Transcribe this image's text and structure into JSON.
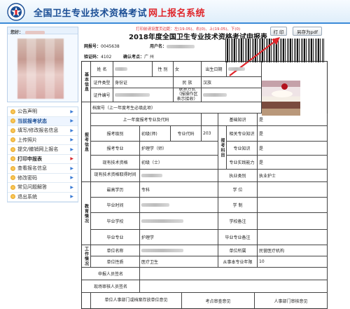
{
  "header": {
    "title": "全国卫生专业技术资格考试",
    "subtitle": "网上报名系统"
  },
  "user": {
    "greeting_label": "您好："
  },
  "sidebar": {
    "items": [
      {
        "label": "公告声明"
      },
      {
        "label": "当前报考状态"
      },
      {
        "label": "填写/修改报名信息"
      },
      {
        "label": "上传照片"
      },
      {
        "label": "提交/撤销网上报名"
      },
      {
        "label": "打印申报表"
      },
      {
        "label": "查看报名信息"
      },
      {
        "label": "修改密码"
      },
      {
        "label": "常见问题解答"
      },
      {
        "label": "退出系统"
      }
    ]
  },
  "toolbar": {
    "notice": "打印前请设置页边距：左(19.05)、右(0)、上(19.05)、下(0)",
    "print_label": "打 印",
    "pdf_label": "另存为pdf"
  },
  "form": {
    "title": "2018年度全国卫生专业技术资格考试申报表",
    "meta": {
      "serial_label": "网报号：",
      "serial_value": "0045638",
      "user_label": "用户名：",
      "code_label": "验证码：",
      "code_value": "4102",
      "site_label": "确认考点：",
      "site_value": "广 州"
    },
    "basic": {
      "section": "基本信息",
      "name_label": "姓 名",
      "gender_label": "性 别",
      "gender_value": "女",
      "birth_label": "出生日期",
      "id_type_label": "证件类型",
      "id_type_value": "身份证",
      "ethnic_label": "民 族",
      "ethnic_value": "汉族",
      "id_no_label": "证件编号",
      "contact_label": "联系方式（报操作区表示接收）"
    },
    "exam": {
      "section": "报考信息",
      "archive_label": "档案号（上一年度考生必填此项）",
      "prev_label": "上一年度报考专业及代码",
      "basic_know_label": "基础知识",
      "basic_know_value": "是",
      "level_label": "报考级别",
      "level_value": "初级(师)",
      "code_label": "专业代码",
      "code_value": "203",
      "subjects_section": "报考科目",
      "related_label": "相关专业知识",
      "related_value": "是",
      "major_label": "报考专业",
      "major_value": "护理学（师）",
      "prof_know_label": "专业知识",
      "prof_know_value": "是",
      "current_label": "现有技术资格",
      "current_value": "初级（士）",
      "practice_label": "专业实践能力",
      "practice_value": "是",
      "obtain_label": "现有技术资格取得时间",
      "practice_type_label": "执业类别",
      "practice_type_value": "执业护士"
    },
    "education": {
      "section": "教育情况",
      "highest_label": "最高学历",
      "highest_value": "专科",
      "degree_label": "学 位",
      "grad_time_label": "毕业时间",
      "school_system_label": "学 制",
      "school_label": "毕业学校",
      "school_note_label": "学校备注",
      "major_label": "毕业专业",
      "major_value": "护理学",
      "major_note_label": "毕业专业备注"
    },
    "work": {
      "section": "工作情况",
      "unit_label": "单位名称",
      "unit_belong_label": "单位所属",
      "unit_belong_value": "民营医疗机构",
      "nature_label": "单位性质",
      "nature_value": "医疗卫生",
      "years_label": "从事本专业年限",
      "years_value": "10"
    },
    "signatures": {
      "applicant_label": "申报人员签名",
      "reviewer_label": "现场审核人员签名",
      "unit_opinion_label": "单位人事部门或档案存放单位意见",
      "site_opinion_label": "考点审查意见",
      "hr_opinion_label": "人事部门审核意见"
    }
  }
}
